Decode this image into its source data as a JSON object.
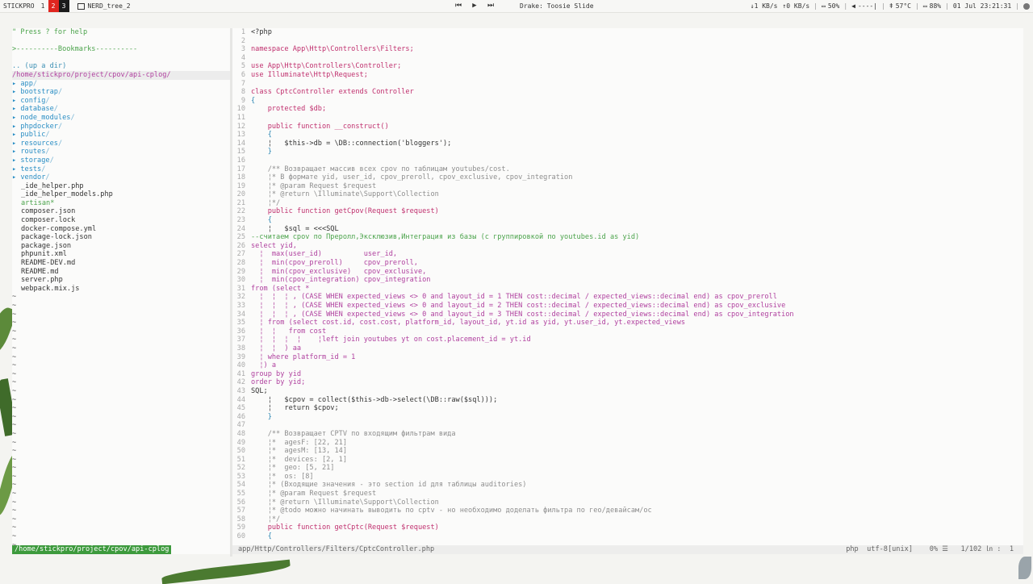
{
  "topbar": {
    "logo": "STICKPRO",
    "workspaces": [
      "1",
      "2",
      "3"
    ],
    "window_title": "NERD_tree_2",
    "track": "Drake: Toosie Slide",
    "net_down": "↓1 KB/s",
    "net_up": "↑0 KB/s",
    "cpu": "50%",
    "volume": "----|",
    "temp": "57°C",
    "battery": "88%",
    "datetime": "01 Jul 23:21:31"
  },
  "nerdtree": {
    "help": "\" Press ? for help",
    "bookmarks": ">----------Bookmarks----------",
    "updir": ".. (up a dir)",
    "cwd": "/home/stickpro/project/cpov/api-cplog/",
    "dirs": [
      "app",
      "bootstrap",
      "config",
      "database",
      "node_modules",
      "phpdocker",
      "public",
      "resources",
      "routes",
      "storage",
      "tests",
      "vendor"
    ],
    "files": [
      {
        "name": "_ide_helper.php",
        "exec": false
      },
      {
        "name": "_ide_helper_models.php",
        "exec": false
      },
      {
        "name": "artisan*",
        "exec": true
      },
      {
        "name": "composer.json",
        "exec": false
      },
      {
        "name": "composer.lock",
        "exec": false
      },
      {
        "name": "docker-compose.yml",
        "exec": false
      },
      {
        "name": "package-lock.json",
        "exec": false
      },
      {
        "name": "package.json",
        "exec": false
      },
      {
        "name": "phpunit.xml",
        "exec": false
      },
      {
        "name": "README-DEV.md",
        "exec": false
      },
      {
        "name": "README.md",
        "exec": false
      },
      {
        "name": "server.php",
        "exec": false
      },
      {
        "name": "webpack.mix.js",
        "exec": false
      }
    ],
    "status_path": "/home/stickpro/project/cpov/api-cplog"
  },
  "editor": {
    "lines": [
      "<?php",
      "",
      "namespace App\\Http\\Controllers\\Filters;",
      "",
      "use App\\Http\\Controllers\\Controller;",
      "use Illuminate\\Http\\Request;",
      "",
      "class CptcController extends Controller",
      "{",
      "    protected $db;",
      "",
      "    public function __construct()",
      "    {",
      "    ¦   $this->db = \\DB::connection('bloggers');",
      "    }",
      "",
      "    /** Возвращает массив всех cpov по таблицам youtubes/cost.",
      "    ¦* В формате yid, user_id, cpov_preroll, cpov_exclusive, cpov_integration",
      "    ¦* @param Request $request",
      "    ¦* @return \\Illuminate\\Support\\Collection",
      "    ¦*/",
      "    public function getCpov(Request $request)",
      "    {",
      "    ¦   $sql = <<<SQL",
      "--считаем cpov по Преролл,Эксклюзив,Интеграция из базы (с группировкой по youtubes.id as yid)",
      "select yid,",
      "  ¦  max(user_id)          user_id,",
      "  ¦  min(cpov_preroll)     cpov_preroll,",
      "  ¦  min(cpov_exclusive)   cpov_exclusive,",
      "  ¦  min(cpov_integration) cpov_integration",
      "from (select *",
      "  ¦  ¦  ¦ , (CASE WHEN expected_views <> 0 and layout_id = 1 THEN cost::decimal / expected_views::decimal end) as cpov_preroll",
      "  ¦  ¦  ¦ , (CASE WHEN expected_views <> 0 and layout_id = 2 THEN cost::decimal / expected_views::decimal end) as cpov_exclusive",
      "  ¦  ¦  ¦ , (CASE WHEN expected_views <> 0 and layout_id = 3 THEN cost::decimal / expected_views::decimal end) as cpov_integration",
      "  ¦ from (select cost.id, cost.cost, platform_id, layout_id, yt.id as yid, yt.user_id, yt.expected_views",
      "  ¦  ¦   from cost",
      "  ¦  ¦  ¦  ¦    ¦left join youtubes yt on cost.placement_id = yt.id",
      "  ¦  ¦  ) aa",
      "  ¦ where platform_id = 1",
      "  ¦) a",
      "group by yid",
      "order by yid;",
      "SQL;",
      "    ¦   $cpov = collect($this->db->select(\\DB::raw($sql)));",
      "    ¦   return $cpov;",
      "    }",
      "",
      "    /** Возвращает CPTV по входящим фильтрам вида",
      "    ¦*  agesF: [22, 21]",
      "    ¦*  agesM: [13, 14]",
      "    ¦*  devices: [2, 1]",
      "    ¦*  geo: [5, 21]",
      "    ¦*  os: [8]",
      "    ¦* (Входящие значения - это section id для таблицы auditories)",
      "    ¦* @param Request $request",
      "    ¦* @return \\Illuminate\\Support\\Collection",
      "    ¦* @todo можно начинать выводить по cptv - но необходимо доделать фильтра по гео/девайсам/ос",
      "    ¦*/",
      "    public function getCptc(Request $request)",
      "    {"
    ],
    "status_file": "app/Http/Controllers/Filters/CptcController.php",
    "status_filetype": "php",
    "status_encoding": "utf-8[unix]",
    "status_percent": "0% ☰",
    "status_position": "1/102 ㏑ :  1"
  }
}
